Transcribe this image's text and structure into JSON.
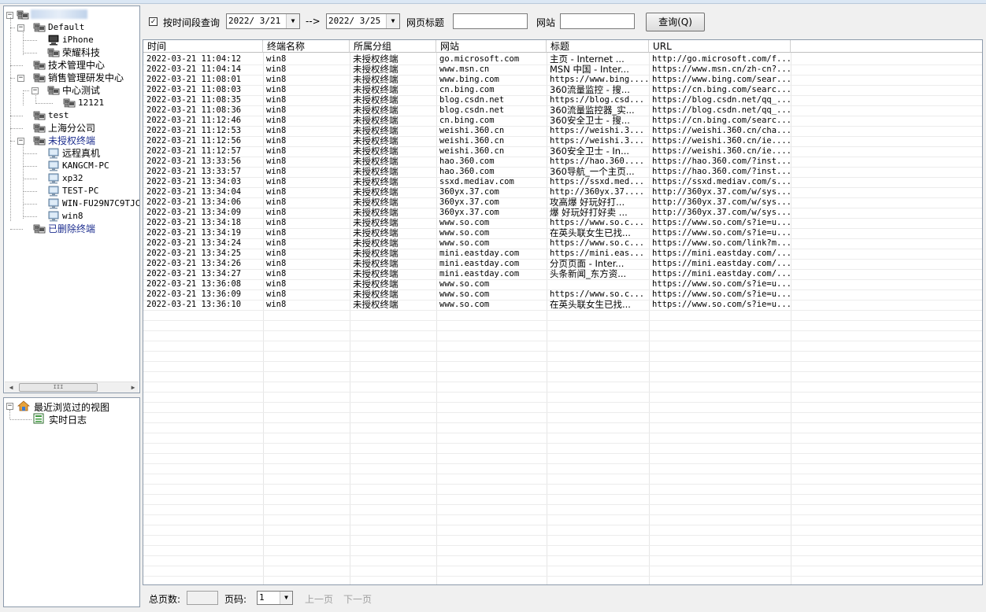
{
  "tree": {
    "root_label": "",
    "nodes": [
      {
        "label": "Default",
        "level": 1,
        "expander": "−",
        "icon": "group-icon"
      },
      {
        "label": "iPhone",
        "level": 2,
        "expander": "",
        "icon": "computer-icon"
      },
      {
        "label": "荣耀科技",
        "level": 2,
        "expander": "",
        "icon": "group-icon"
      },
      {
        "label": "技术管理中心",
        "level": 1,
        "expander": "",
        "icon": "group-icon"
      },
      {
        "label": "销售管理研发中心",
        "level": 1,
        "expander": "−",
        "icon": "group-icon"
      },
      {
        "label": "中心测试",
        "level": 2,
        "expander": "−",
        "icon": "group-icon"
      },
      {
        "label": "12121",
        "level": 3,
        "expander": "",
        "icon": "group-icon"
      },
      {
        "label": "test",
        "level": 1,
        "expander": "",
        "icon": "group-icon"
      },
      {
        "label": "上海分公司",
        "level": 1,
        "expander": "",
        "icon": "group-icon"
      },
      {
        "label": "未授权终端",
        "level": 1,
        "expander": "−",
        "icon": "group-icon",
        "highlight": true
      },
      {
        "label": "远程真机",
        "level": 2,
        "expander": "",
        "icon": "monitor-icon"
      },
      {
        "label": "KANGCM-PC",
        "level": 2,
        "expander": "",
        "icon": "monitor-icon"
      },
      {
        "label": "xp32",
        "level": 2,
        "expander": "",
        "icon": "monitor-icon"
      },
      {
        "label": "TEST-PC",
        "level": 2,
        "expander": "",
        "icon": "monitor-icon"
      },
      {
        "label": "WIN-FU29N7C9TJC",
        "level": 2,
        "expander": "",
        "icon": "monitor-icon"
      },
      {
        "label": "win8",
        "level": 2,
        "expander": "",
        "icon": "monitor-icon"
      },
      {
        "label": "已删除终端",
        "level": 1,
        "expander": "",
        "icon": "group-icon",
        "highlight": true
      }
    ],
    "scrollbar_grip": "III"
  },
  "views_tree": {
    "root_label": "最近浏览过的视图",
    "child_label": "实时日志"
  },
  "toolbar": {
    "checkbox_checked": "✓",
    "time_range_label": "按时间段查询",
    "date_from": "2022/ 3/21",
    "arrow_label": "-->",
    "date_to": "2022/ 3/25",
    "page_title_label": "网页标题",
    "site_label": "网站",
    "query_button": "查询(Q)"
  },
  "table": {
    "columns": [
      "时间",
      "终端名称",
      "所属分组",
      "网站",
      "标题",
      "URL"
    ],
    "rows": [
      [
        "2022-03-21 11:04:12",
        "win8",
        "未授权终端",
        "go.microsoft.com",
        "主页 - Internet ...",
        "http://go.microsoft.com/f..."
      ],
      [
        "2022-03-21 11:04:14",
        "win8",
        "未授权终端",
        "www.msn.cn",
        "MSN 中国 - Inter...",
        "https://www.msn.cn/zh-cn?..."
      ],
      [
        "2022-03-21 11:08:01",
        "win8",
        "未授权终端",
        "www.bing.com",
        "https://www.bing....",
        "https://www.bing.com/sear..."
      ],
      [
        "2022-03-21 11:08:03",
        "win8",
        "未授权终端",
        "cn.bing.com",
        "360流量监控 - 搜...",
        "https://cn.bing.com/searc..."
      ],
      [
        "2022-03-21 11:08:35",
        "win8",
        "未授权终端",
        "blog.csdn.net",
        "https://blog.csd...",
        "https://blog.csdn.net/qq_..."
      ],
      [
        "2022-03-21 11:08:36",
        "win8",
        "未授权终端",
        "blog.csdn.net",
        "360流量监控器_实...",
        "https://blog.csdn.net/qq_..."
      ],
      [
        "2022-03-21 11:12:46",
        "win8",
        "未授权终端",
        "cn.bing.com",
        "360安全卫士 - 搜...",
        "https://cn.bing.com/searc..."
      ],
      [
        "2022-03-21 11:12:53",
        "win8",
        "未授权终端",
        "weishi.360.cn",
        "https://weishi.3...",
        "https://weishi.360.cn/cha..."
      ],
      [
        "2022-03-21 11:12:56",
        "win8",
        "未授权终端",
        "weishi.360.cn",
        "https://weishi.3...",
        "https://weishi.360.cn/ie...."
      ],
      [
        "2022-03-21 11:12:57",
        "win8",
        "未授权终端",
        "weishi.360.cn",
        "360安全卫士 - In...",
        "https://weishi.360.cn/ie...."
      ],
      [
        "2022-03-21 13:33:56",
        "win8",
        "未授权终端",
        "hao.360.com",
        "https://hao.360....",
        "https://hao.360.com/?inst..."
      ],
      [
        "2022-03-21 13:33:57",
        "win8",
        "未授权终端",
        "hao.360.com",
        "360导航_一个主页...",
        "https://hao.360.com/?inst..."
      ],
      [
        "2022-03-21 13:34:03",
        "win8",
        "未授权终端",
        "ssxd.mediav.com",
        "https://ssxd.med...",
        "https://ssxd.mediav.com/s..."
      ],
      [
        "2022-03-21 13:34:04",
        "win8",
        "未授权终端",
        "360yx.37.com",
        "http://360yx.37....",
        "http://360yx.37.com/w/sys..."
      ],
      [
        "2022-03-21 13:34:06",
        "win8",
        "未授权终端",
        "360yx.37.com",
        "攻高爆 好玩好打...",
        "http://360yx.37.com/w/sys..."
      ],
      [
        "2022-03-21 13:34:09",
        "win8",
        "未授权终端",
        "360yx.37.com",
        "爆 好玩好打好卖 ...",
        "http://360yx.37.com/w/sys..."
      ],
      [
        "2022-03-21 13:34:18",
        "win8",
        "未授权终端",
        "www.so.com",
        "https://www.so.c...",
        "https://www.so.com/s?ie=u..."
      ],
      [
        "2022-03-21 13:34:19",
        "win8",
        "未授权终端",
        "www.so.com",
        "在英头联女生已找...",
        "https://www.so.com/s?ie=u..."
      ],
      [
        "2022-03-21 13:34:24",
        "win8",
        "未授权终端",
        "www.so.com",
        "https://www.so.c...",
        "https://www.so.com/link?m..."
      ],
      [
        "2022-03-21 13:34:25",
        "win8",
        "未授权终端",
        "mini.eastday.com",
        "https://mini.eas...",
        "https://mini.eastday.com/..."
      ],
      [
        "2022-03-21 13:34:26",
        "win8",
        "未授权终端",
        "mini.eastday.com",
        "分页页面 - Inter...",
        "https://mini.eastday.com/..."
      ],
      [
        "2022-03-21 13:34:27",
        "win8",
        "未授权终端",
        "mini.eastday.com",
        "头条新闻_东方资...",
        "https://mini.eastday.com/..."
      ],
      [
        "2022-03-21 13:36:08",
        "win8",
        "未授权终端",
        "www.so.com",
        "",
        "https://www.so.com/s?ie=u..."
      ],
      [
        "2022-03-21 13:36:09",
        "win8",
        "未授权终端",
        "www.so.com",
        "https://www.so.c...",
        "https://www.so.com/s?ie=u..."
      ],
      [
        "2022-03-21 13:36:10",
        "win8",
        "未授权终端",
        "www.so.com",
        "在英头联女生已找...",
        "https://www.so.com/s?ie=u..."
      ]
    ]
  },
  "status": {
    "total_pages_label": "总页数:",
    "page_label": "页码:",
    "page_value": "1",
    "prev_label": "上一页",
    "next_label": "下一页"
  }
}
